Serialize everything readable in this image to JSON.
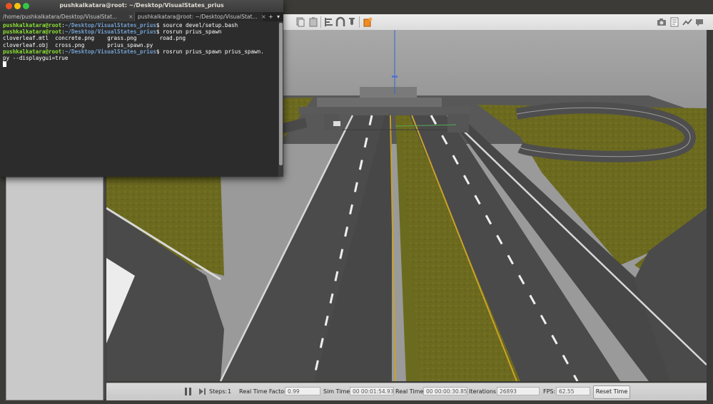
{
  "terminal": {
    "title": "pushkalkatara@root: ~/Desktop/VisualStates_prius",
    "tabs": [
      {
        "label": "/home/pushkalkatara/Desktop/VisualStat..."
      },
      {
        "label": "pushkalkatara@root: ~/Desktop/VisualStat..."
      }
    ],
    "tab_close": "×",
    "new_tab": "+",
    "menu_arrow": "▾",
    "prompt_user": "pushkalkatara@root",
    "prompt_path": "~/Desktop/VisualStates_prius",
    "lines": [
      {
        "type": "cmd",
        "text": "source devel/setup.bash"
      },
      {
        "type": "cmd",
        "text": "rosrun prius_spawn"
      },
      {
        "type": "out",
        "text": "cloverleaf.mtl  concrete.png    grass.png       road.png"
      },
      {
        "type": "out",
        "text": "cloverleaf.obj  cross.png       prius_spawn.py"
      },
      {
        "type": "cmd",
        "text": "rosrun prius_spawn prius_spawn."
      },
      {
        "type": "out",
        "text": "py --displaygui=true"
      }
    ],
    "colors": {
      "red": "#e95420",
      "yellow": "#f5c211",
      "green": "#33c748",
      "prompt": "#8ae234",
      "path": "#729fcf"
    }
  },
  "gazebo": {
    "toolbar_icons": [
      "copy-icon",
      "paste-icon",
      "align-icon",
      "snap-icon",
      "magnet-icon",
      "shape-icon",
      "screenshot-icon",
      "log-icon",
      "plot-icon",
      "video-icon"
    ],
    "bottom_bar": {
      "steps_label": "Steps:",
      "steps_value": "1",
      "rtf_label": "Real Time Factor:",
      "rtf_value": "0.99",
      "sim_time_label": "Sim Time:",
      "sim_time_value": "00 00:01:54.932",
      "real_time_label": "Real Time:",
      "real_time_value": "00 00:00:30.856",
      "iterations_label": "Iterations:",
      "iterations_value": "26893",
      "fps_label": "FPS:",
      "fps_value": "62.55",
      "reset_label": "Reset Time"
    }
  }
}
